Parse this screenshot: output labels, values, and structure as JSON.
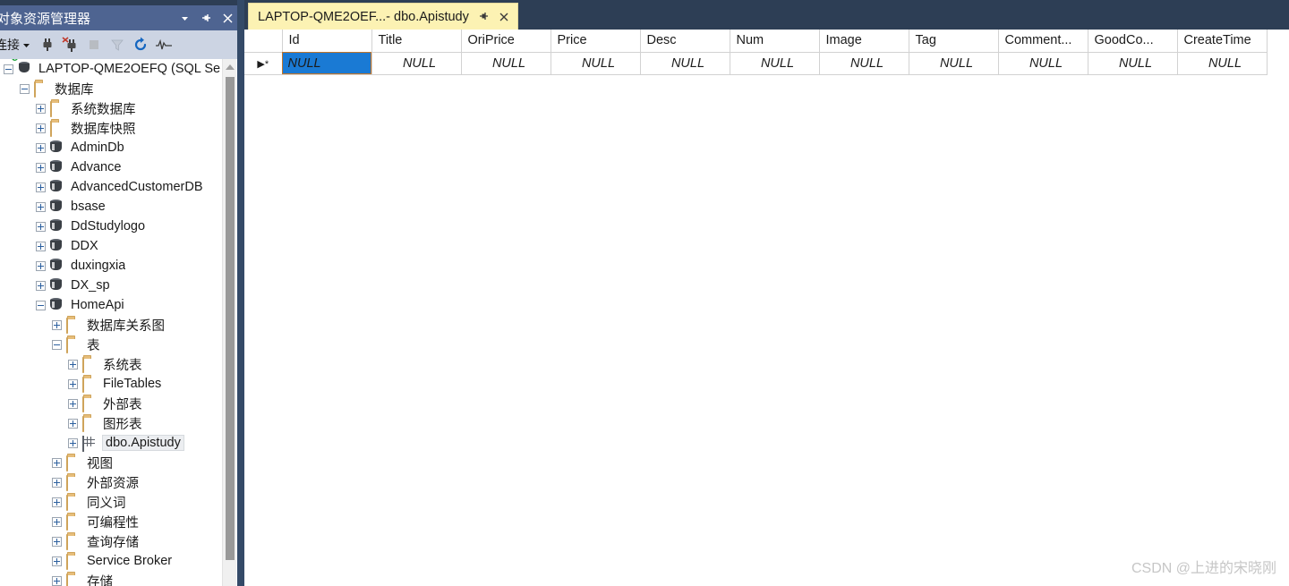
{
  "object_explorer": {
    "title": "对象资源管理器",
    "title_buttons": [
      {
        "name": "dropdown-icon",
        "glyph": "▼"
      },
      {
        "name": "pin-icon",
        "glyph": "⇱"
      },
      {
        "name": "close-icon",
        "glyph": "✕"
      }
    ],
    "toolbar": {
      "connect_label": "连接",
      "connect_caret": "▼",
      "buttons": [
        {
          "name": "connect-icon",
          "title": "连接"
        },
        {
          "name": "disconnect-icon",
          "title": "断开连接"
        },
        {
          "name": "stop-icon",
          "title": "停止"
        },
        {
          "name": "filter-icon",
          "title": "筛选器"
        },
        {
          "name": "refresh-icon",
          "title": "刷新"
        },
        {
          "name": "activity-monitor-icon",
          "title": "活动监视器"
        }
      ]
    },
    "tree": [
      {
        "label": "LAPTOP-QME2OEFQ (SQL Se",
        "indent": 0,
        "icon": "server",
        "state": "expanded",
        "selected": false
      },
      {
        "label": "数据库",
        "indent": 1,
        "icon": "folder",
        "state": "expanded",
        "selected": false
      },
      {
        "label": "系统数据库",
        "indent": 2,
        "icon": "folder",
        "state": "collapsed",
        "selected": false
      },
      {
        "label": "数据库快照",
        "indent": 2,
        "icon": "folder",
        "state": "collapsed",
        "selected": false
      },
      {
        "label": "AdminDb",
        "indent": 2,
        "icon": "database",
        "state": "collapsed",
        "selected": false
      },
      {
        "label": "Advance",
        "indent": 2,
        "icon": "database",
        "state": "collapsed",
        "selected": false
      },
      {
        "label": "AdvancedCustomerDB",
        "indent": 2,
        "icon": "database",
        "state": "collapsed",
        "selected": false
      },
      {
        "label": "bsase",
        "indent": 2,
        "icon": "database",
        "state": "collapsed",
        "selected": false
      },
      {
        "label": "DdStudylogo",
        "indent": 2,
        "icon": "database",
        "state": "collapsed",
        "selected": false
      },
      {
        "label": "DDX",
        "indent": 2,
        "icon": "database",
        "state": "collapsed",
        "selected": false
      },
      {
        "label": "duxingxia",
        "indent": 2,
        "icon": "database",
        "state": "collapsed",
        "selected": false
      },
      {
        "label": "DX_sp",
        "indent": 2,
        "icon": "database",
        "state": "collapsed",
        "selected": false
      },
      {
        "label": "HomeApi",
        "indent": 2,
        "icon": "database",
        "state": "expanded",
        "selected": false
      },
      {
        "label": "数据库关系图",
        "indent": 3,
        "icon": "folder",
        "state": "collapsed",
        "selected": false
      },
      {
        "label": "表",
        "indent": 3,
        "icon": "folder",
        "state": "expanded",
        "selected": false
      },
      {
        "label": "系统表",
        "indent": 4,
        "icon": "folder",
        "state": "collapsed",
        "selected": false
      },
      {
        "label": "FileTables",
        "indent": 4,
        "icon": "folder",
        "state": "collapsed",
        "selected": false
      },
      {
        "label": "外部表",
        "indent": 4,
        "icon": "folder",
        "state": "collapsed",
        "selected": false
      },
      {
        "label": "图形表",
        "indent": 4,
        "icon": "folder",
        "state": "collapsed",
        "selected": false
      },
      {
        "label": "dbo.Apistudy",
        "indent": 4,
        "icon": "table",
        "state": "collapsed",
        "selected": true
      },
      {
        "label": "视图",
        "indent": 3,
        "icon": "folder",
        "state": "collapsed",
        "selected": false
      },
      {
        "label": "外部资源",
        "indent": 3,
        "icon": "folder",
        "state": "collapsed",
        "selected": false
      },
      {
        "label": "同义词",
        "indent": 3,
        "icon": "folder",
        "state": "collapsed",
        "selected": false
      },
      {
        "label": "可编程性",
        "indent": 3,
        "icon": "folder",
        "state": "collapsed",
        "selected": false
      },
      {
        "label": "查询存储",
        "indent": 3,
        "icon": "folder",
        "state": "collapsed",
        "selected": false
      },
      {
        "label": "Service Broker",
        "indent": 3,
        "icon": "folder",
        "state": "collapsed",
        "selected": false
      },
      {
        "label": "存储",
        "indent": 3,
        "icon": "folder",
        "state": "collapsed",
        "selected": false
      }
    ]
  },
  "editor": {
    "tab": {
      "title": "LAPTOP-QME2OEF...- dbo.Apistudy",
      "pin_glyph": "⇲",
      "close_glyph": "✕",
      "background": "#fcf2b3"
    },
    "grid": {
      "row_header_width_label": "",
      "columns": [
        "Id",
        "Title",
        "OriPrice",
        "Price",
        "Desc",
        "Num",
        "Image",
        "Tag",
        "Comment...",
        "GoodCo...",
        "CreateTime"
      ],
      "rows": [
        {
          "row_marker": "▶*",
          "cells": [
            "NULL",
            "NULL",
            "NULL",
            "NULL",
            "NULL",
            "NULL",
            "NULL",
            "NULL",
            "NULL",
            "NULL",
            "NULL"
          ],
          "selected_cell_index": 0
        }
      ],
      "selection_color": "#1a7ad4",
      "selection_border_color": "#c0752a"
    }
  },
  "watermark": "CSDN @上进的宋晓刚"
}
